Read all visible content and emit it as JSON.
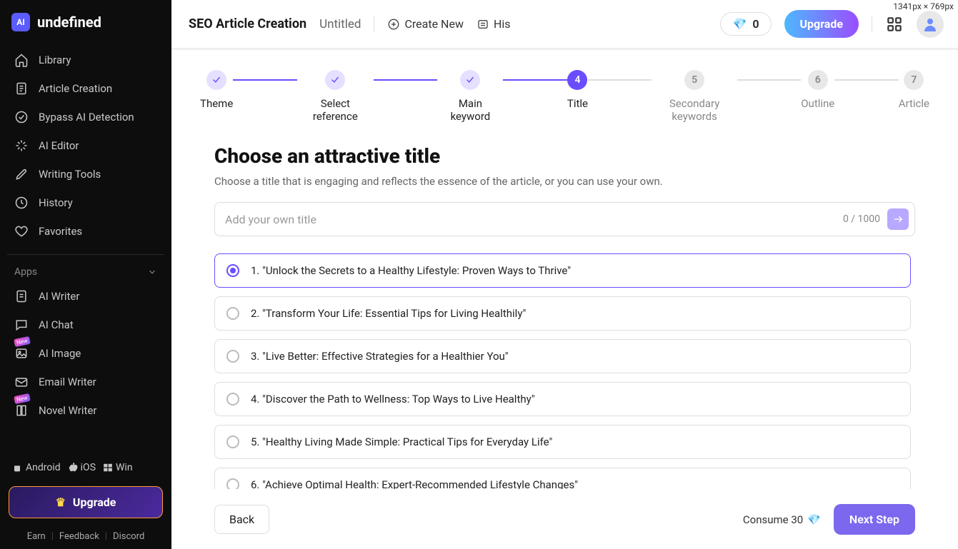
{
  "brand": {
    "logo_label": "AI",
    "name": "undefined"
  },
  "sidebar": {
    "items": [
      {
        "label": "Library"
      },
      {
        "label": "Article Creation"
      },
      {
        "label": "Bypass AI Detection"
      },
      {
        "label": "AI Editor"
      },
      {
        "label": "Writing Tools"
      },
      {
        "label": "History"
      },
      {
        "label": "Favorites"
      }
    ],
    "apps_header": "Apps",
    "apps": [
      {
        "label": "AI Writer",
        "new": false
      },
      {
        "label": "AI Chat",
        "new": false
      },
      {
        "label": "AI Image",
        "new": true
      },
      {
        "label": "Email Writer",
        "new": false
      },
      {
        "label": "Novel Writer",
        "new": true
      }
    ],
    "platforms": [
      "Android",
      "iOS",
      "Win"
    ],
    "upgrade_label": "Upgrade",
    "footer": [
      "Earn",
      "Feedback",
      "Discord"
    ]
  },
  "topbar": {
    "title": "SEO Article Creation",
    "doc": "Untitled",
    "create_new": "Create New",
    "history": "His",
    "credits": "0",
    "upgrade": "Upgrade",
    "dimensions": "1341px × 769px"
  },
  "stepper": [
    {
      "label": "Theme",
      "state": "done"
    },
    {
      "label": "Select reference",
      "state": "done"
    },
    {
      "label": "Main keyword",
      "state": "done"
    },
    {
      "label": "Title",
      "state": "current",
      "num": "4"
    },
    {
      "label": "Secondary keywords",
      "state": "future",
      "num": "5"
    },
    {
      "label": "Outline",
      "state": "future",
      "num": "6"
    },
    {
      "label": "Article",
      "state": "future",
      "num": "7"
    }
  ],
  "page": {
    "heading": "Choose an attractive title",
    "subhead": "Choose a title that is engaging and reflects the essence of the article, or you can use your own.",
    "input_placeholder": "Add your own title",
    "char_count": "0 / 1000",
    "options": [
      "1. \"Unlock the Secrets to a Healthy Lifestyle: Proven Ways to Thrive\"",
      "2. \"Transform Your Life: Essential Tips for Living Healthily\"",
      "3. \"Live Better: Effective Strategies for a Healthier You\"",
      "4. \"Discover the Path to Wellness: Top Ways to Live Healthy\"",
      "5. \"Healthy Living Made Simple: Practical Tips for Everyday Life\"",
      "6. \"Achieve Optimal Health: Expert-Recommended Lifestyle Changes\""
    ],
    "selected_index": 0
  },
  "footer": {
    "back": "Back",
    "consume": "Consume 30",
    "next": "Next Step"
  }
}
